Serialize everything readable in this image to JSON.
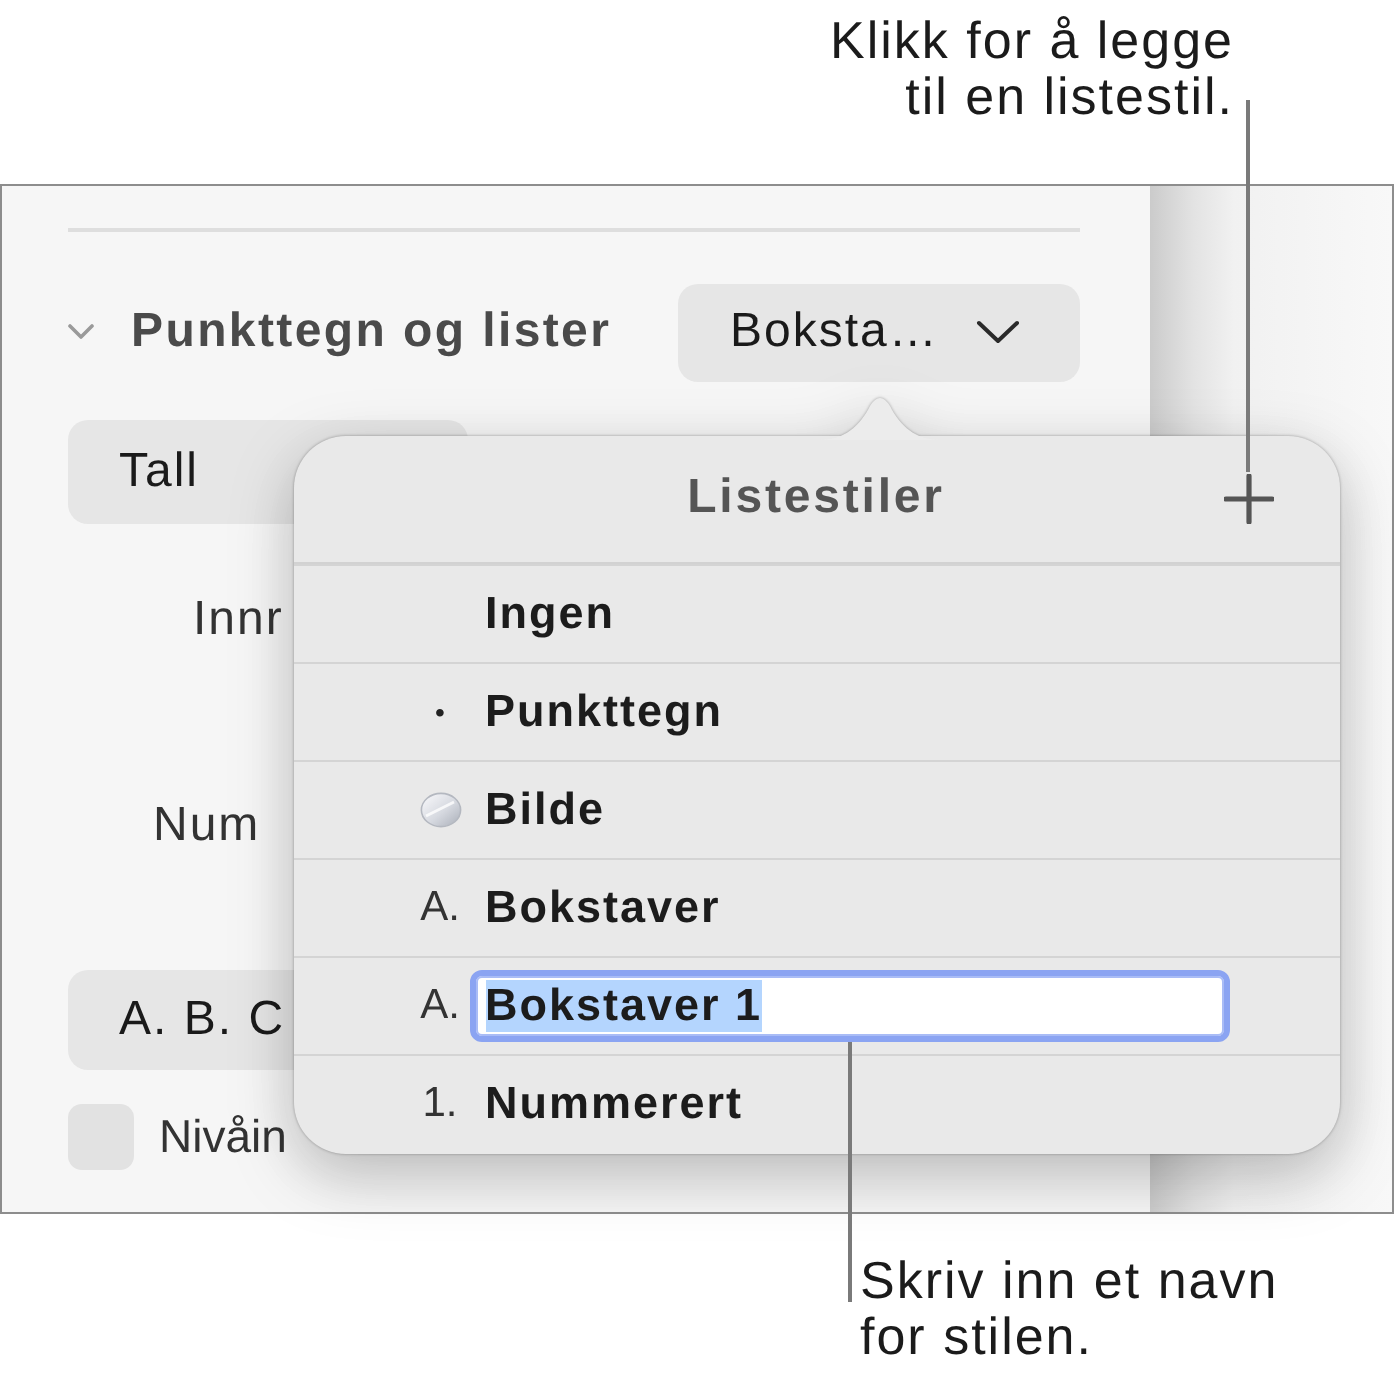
{
  "callouts": [
    {
      "kind": "top",
      "text": "Klikk for å legge til en listestil."
    },
    {
      "kind": "bottom",
      "text": "Skriv inn et navn for stilen."
    }
  ],
  "sidebar": {
    "section": {
      "title": "Punkttegn og lister",
      "expanded": true,
      "style_button": "Boksta…"
    },
    "number_popup": "Tall",
    "labels": [
      "Innr",
      "Num"
    ],
    "format_popup": "A. B. C",
    "checkbox": {
      "label": "Nivåin",
      "checked": false
    }
  },
  "popover": {
    "title": "Listestiler",
    "items": [
      {
        "kind": "none",
        "name": "Ingen",
        "editing": false
      },
      {
        "kind": "bullet",
        "marker": "•",
        "name": "Punkttegn",
        "editing": false
      },
      {
        "kind": "image",
        "name": "Bilde",
        "editing": false
      },
      {
        "kind": "text",
        "marker": "A.",
        "name": "Bokstaver",
        "editing": false
      },
      {
        "kind": "text",
        "marker": "A.",
        "name": "Bokstaver 1",
        "editing": true
      },
      {
        "kind": "text",
        "marker": "1.",
        "name": "Nummerert",
        "editing": false
      }
    ]
  }
}
